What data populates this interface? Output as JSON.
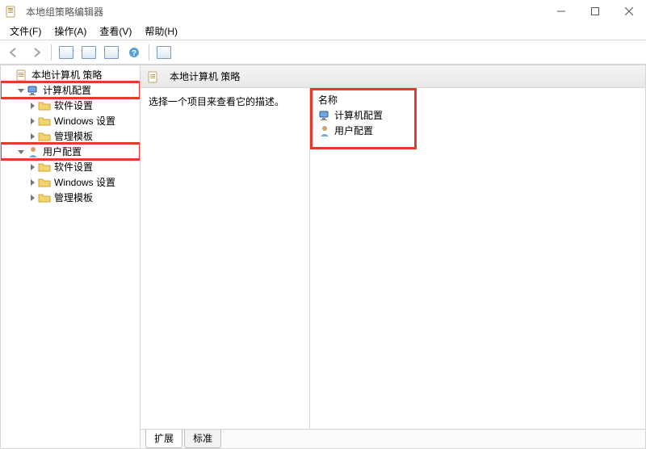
{
  "window": {
    "title": "本地组策略编辑器"
  },
  "menubar": {
    "file": "文件(F)",
    "action": "操作(A)",
    "view": "查看(V)",
    "help": "帮助(H)"
  },
  "tree": {
    "root": "本地计算机 策略",
    "computer_config": "计算机配置",
    "user_config": "用户配置",
    "children": {
      "software_settings": "软件设置",
      "windows_settings": "Windows 设置",
      "admin_templates": "管理模板"
    }
  },
  "content": {
    "header_title": "本地计算机 策略",
    "description_prompt": "选择一个项目来查看它的描述。",
    "column_name": "名称",
    "items": {
      "computer_config": "计算机配置",
      "user_config": "用户配置"
    },
    "tabs": {
      "extended": "扩展",
      "standard": "标准"
    }
  }
}
